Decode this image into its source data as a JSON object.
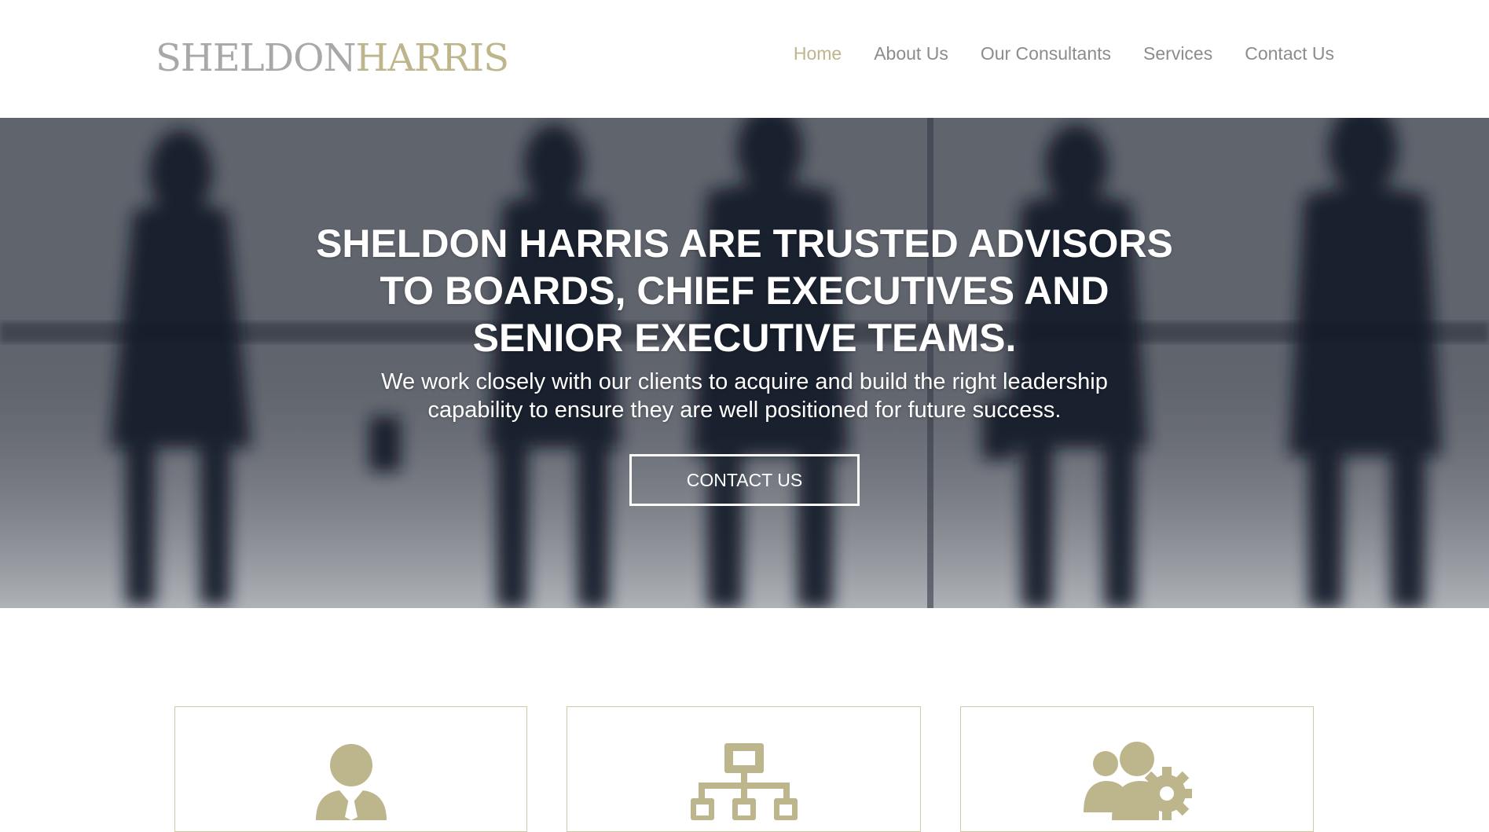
{
  "header": {
    "logo": {
      "part1": "SHELDON",
      "part2": "HARRIS"
    },
    "nav": [
      {
        "label": "Home",
        "active": true
      },
      {
        "label": "About Us",
        "active": false
      },
      {
        "label": "Our Consultants",
        "active": false
      },
      {
        "label": "Services",
        "active": false
      },
      {
        "label": "Contact Us",
        "active": false
      }
    ]
  },
  "hero": {
    "title": "SHELDON HARRIS ARE TRUSTED ADVISORS TO BOARDS, CHIEF EXECUTIVES AND SENIOR EXECUTIVE TEAMS.",
    "subtitle": "We work closely with our clients to acquire and build the right leadership capability to ensure they are well positioned for future success.",
    "button_label": "CONTACT US"
  },
  "cards": [
    {
      "icon": "businessman-icon"
    },
    {
      "icon": "org-chart-icon"
    },
    {
      "icon": "team-settings-icon"
    }
  ],
  "colors": {
    "accent": "#bdb58b",
    "nav_text": "#8c8c8c",
    "logo_grey": "#a8a8a8",
    "card_border": "#cfc9a5"
  }
}
